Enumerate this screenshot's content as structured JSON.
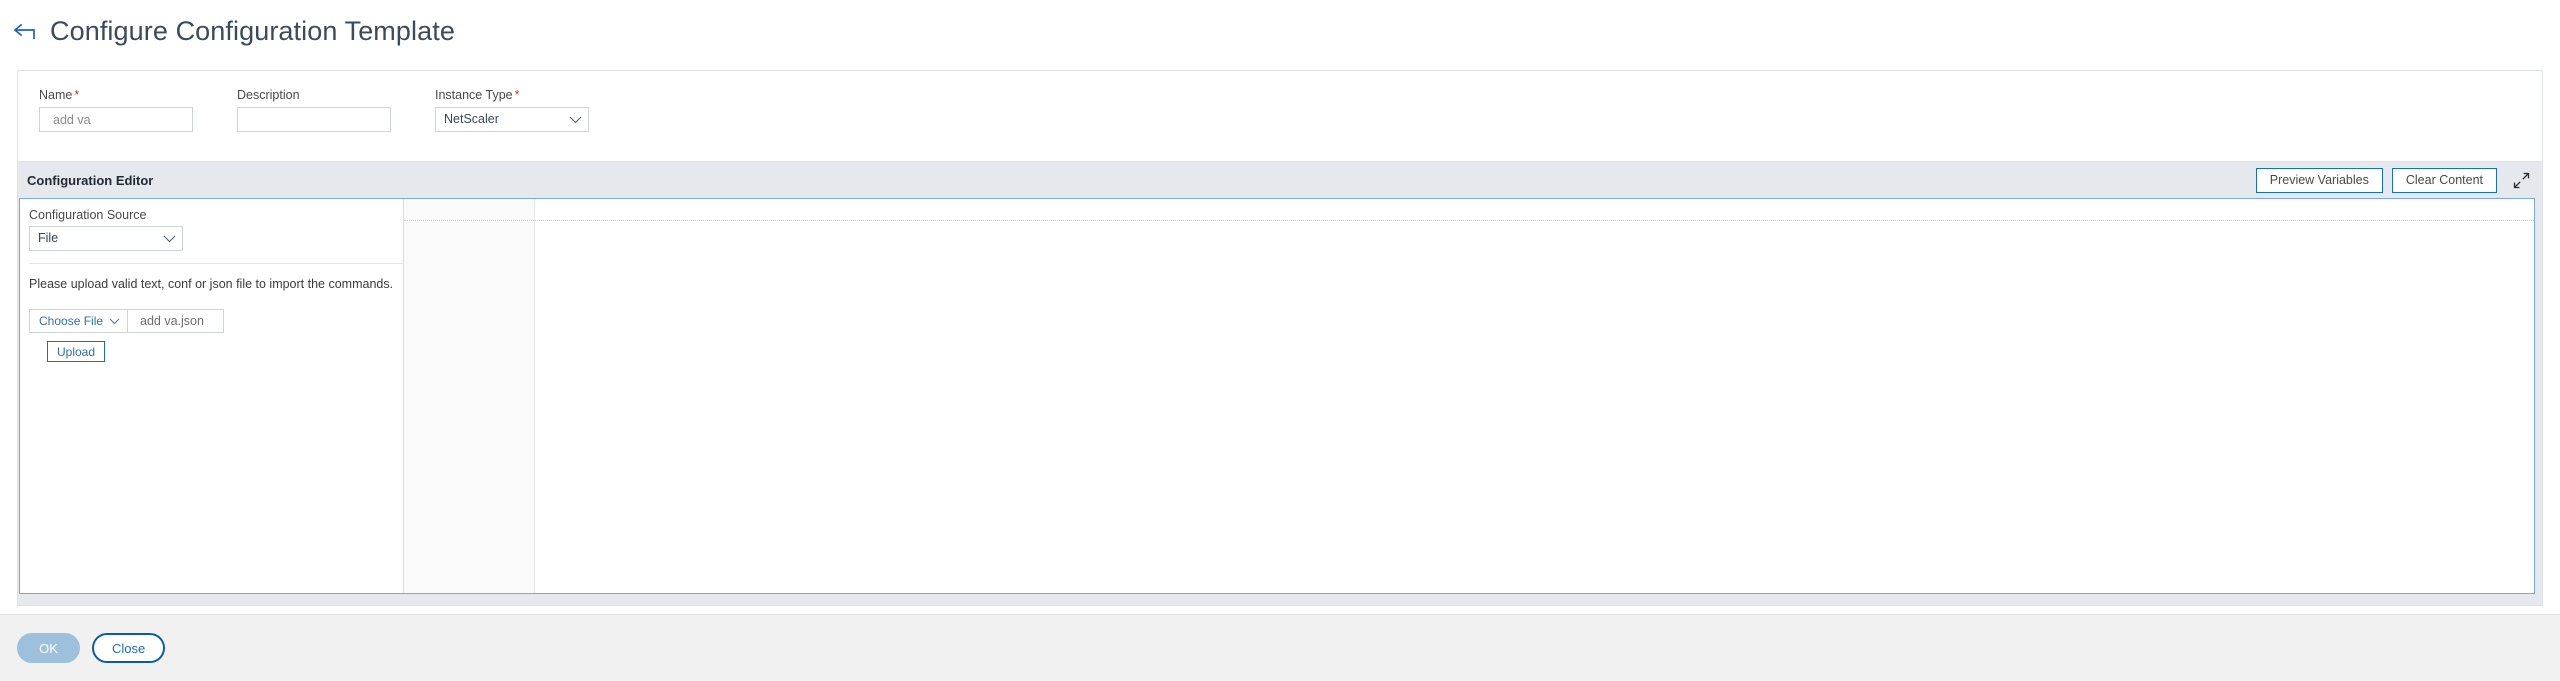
{
  "header": {
    "back_icon": "back-arrow-icon",
    "title": "Configure Configuration Template"
  },
  "form": {
    "name": {
      "label": "Name",
      "required": "*",
      "value": "add va",
      "placeholder": "add va"
    },
    "description": {
      "label": "Description",
      "required": "",
      "value": "",
      "placeholder": ""
    },
    "instance_type": {
      "label": "Instance Type",
      "required": "*",
      "value": "NetScaler",
      "options": [
        "NetScaler"
      ],
      "caret_icon": "chevron-down-icon"
    }
  },
  "editor": {
    "title": "Configuration Editor",
    "preview_variables_label": "Preview Variables",
    "clear_content_label": "Clear Content",
    "expand_icon": "expand-diagonal-icon",
    "source": {
      "label": "Configuration Source",
      "value": "File",
      "options": [
        "File"
      ],
      "caret_icon": "chevron-down-icon"
    },
    "hint": "Please upload valid text, conf or json file to import the commands.",
    "choose_file_label": "Choose File",
    "choose_file_caret_icon": "chevron-down-icon",
    "file_name": "add va.json",
    "upload_label": "Upload",
    "content": ""
  },
  "footer": {
    "ok_label": "OK",
    "close_label": "Close"
  },
  "colors": {
    "accent_blue": "#1a6fbd",
    "link_blue": "#2f6fb0",
    "panel_gray": "#e5e9ee",
    "footer_gray": "#f1f1f1",
    "required_red": "#c0392b",
    "ok_disabled": "#9dc0dd"
  }
}
